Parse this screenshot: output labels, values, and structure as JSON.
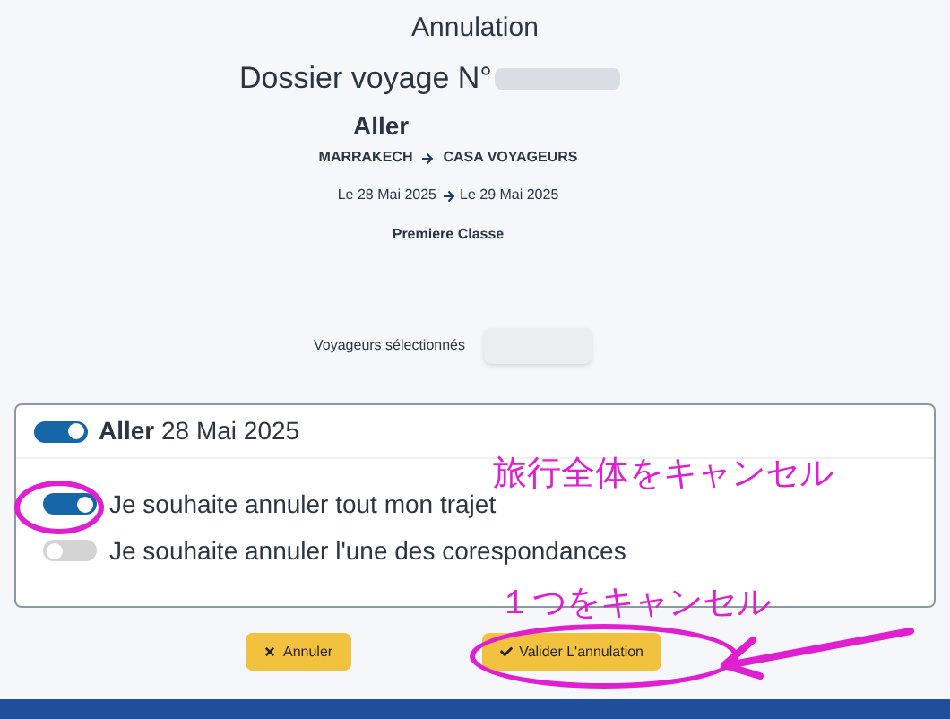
{
  "title": "Annulation",
  "dossier": {
    "label": "Dossier voyage N°"
  },
  "trip": {
    "direction": "Aller",
    "from": "MARRAKECH",
    "to": "CASA VOYAGEURS",
    "date_from": "Le 28 Mai 2025",
    "date_to": "Le 29 Mai 2025",
    "class": "Premiere Classe"
  },
  "travellers": {
    "label": "Voyageurs sélectionnés"
  },
  "card": {
    "header": {
      "on": true,
      "direction": "Aller",
      "date": "28 Mai 2025"
    },
    "options": [
      {
        "label": "Je souhaite annuler tout mon trajet",
        "on": true
      },
      {
        "label": "Je souhaite annuler l'une des corespondances",
        "on": false
      }
    ]
  },
  "buttons": [
    {
      "kind": "cancel",
      "label": "Annuler"
    },
    {
      "kind": "confirm",
      "label": "Valider L'annulation"
    }
  ],
  "annotations": [
    {
      "text": "旅行全体をキャンセル"
    },
    {
      "text": "１つをキャンセル"
    }
  ]
}
